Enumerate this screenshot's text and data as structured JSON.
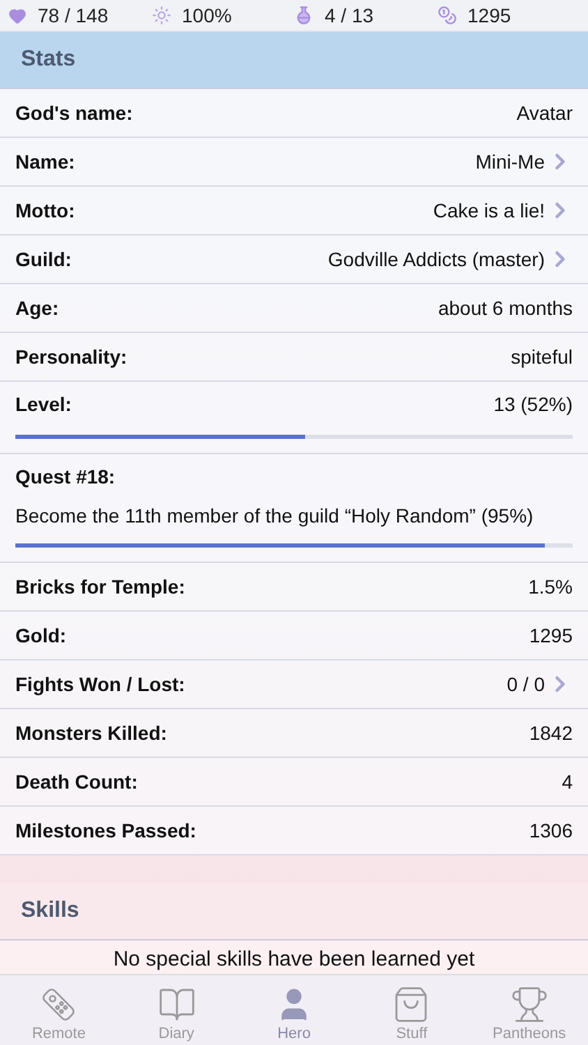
{
  "status_bar": {
    "health": "78 / 148",
    "prana": "100%",
    "inventory": "4 / 13",
    "gold": "1295"
  },
  "stats": {
    "title": "Stats",
    "rows": [
      {
        "kind": "text",
        "label": "God's name:",
        "value": "Avatar"
      },
      {
        "kind": "link",
        "label": "Name:",
        "value": "Mini-Me"
      },
      {
        "kind": "link",
        "label": "Motto:",
        "value": "Cake is a lie!"
      },
      {
        "kind": "link",
        "label": "Guild:",
        "value": "Godville Addicts (master)"
      },
      {
        "kind": "text",
        "label": "Age:",
        "value": "about 6 months"
      },
      {
        "kind": "text",
        "label": "Personality:",
        "value": "spiteful"
      },
      {
        "kind": "progress",
        "label": "Level:",
        "value": "13 (52%)",
        "level": 0.52
      },
      {
        "kind": "quest",
        "label": "Quest #18:",
        "value": "Become the 11th member of the guild “Holy Random” (95%)",
        "level": 0.95
      },
      {
        "kind": "text",
        "label": "Bricks for Temple:",
        "value": "1.5%"
      },
      {
        "kind": "text",
        "label": "Gold:",
        "value": "1295"
      },
      {
        "kind": "link",
        "label": "Fights Won / Lost:",
        "value": "0 / 0"
      },
      {
        "kind": "text",
        "label": "Monsters Killed:",
        "value": "1842"
      },
      {
        "kind": "text",
        "label": "Death Count:",
        "value": "4"
      },
      {
        "kind": "text",
        "label": "Milestones Passed:",
        "value": "1306"
      }
    ]
  },
  "skills": {
    "title": "Skills",
    "message": "No special skills have been learned yet"
  },
  "tabs": [
    {
      "kind": "remote",
      "label": "Remote",
      "selected": false
    },
    {
      "kind": "diary",
      "label": "Diary",
      "selected": false
    },
    {
      "kind": "hero",
      "label": "Hero",
      "selected": true
    },
    {
      "kind": "stuff",
      "label": "Stuff",
      "selected": false
    },
    {
      "kind": "pantheons",
      "label": "Pantheons",
      "selected": false
    }
  ]
}
